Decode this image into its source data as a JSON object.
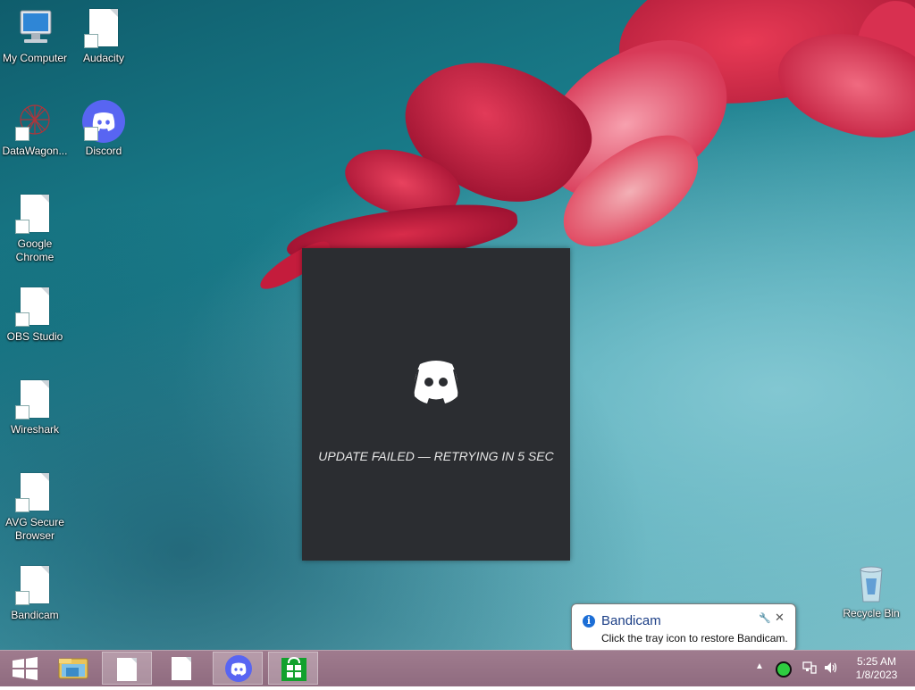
{
  "desktop_icons": [
    {
      "label": "My Computer",
      "icon": "computer-icon"
    },
    {
      "label": "Audacity",
      "icon": "file-icon"
    },
    {
      "label": "DataWagon...",
      "icon": "datawagon-icon"
    },
    {
      "label": "Discord",
      "icon": "discord-icon"
    },
    {
      "label": "Google Chrome",
      "icon": "file-icon"
    },
    {
      "label": "OBS Studio",
      "icon": "file-icon"
    },
    {
      "label": "Wireshark",
      "icon": "file-icon"
    },
    {
      "label": "AVG Secure Browser",
      "icon": "file-icon"
    },
    {
      "label": "Bandicam",
      "icon": "file-icon"
    },
    {
      "label": "Recycle Bin",
      "icon": "recycle-bin-icon"
    }
  ],
  "splash": {
    "status_text": "UPDATE FAILED — RETRYING IN 5 SEC",
    "background": "#2b2d31"
  },
  "notification": {
    "title": "Bandicam",
    "body": "Click the tray icon to restore Bandicam.",
    "icon": "info-icon",
    "settings_glyph": "🔧",
    "close_glyph": "✕"
  },
  "taskbar": {
    "items": [
      "start-button",
      "file-explorer",
      "document",
      "document",
      "discord",
      "store"
    ],
    "active_items": [
      "document-1",
      "discord"
    ],
    "tray_arrow": "▲"
  },
  "clock": {
    "time": "5:25 AM",
    "date": "1/8/2023"
  },
  "colors": {
    "discord_brand": "#5865f2",
    "taskbar": "#9a7689",
    "balloon_title": "#1c3f86",
    "tray_record": "#2ecc40"
  }
}
